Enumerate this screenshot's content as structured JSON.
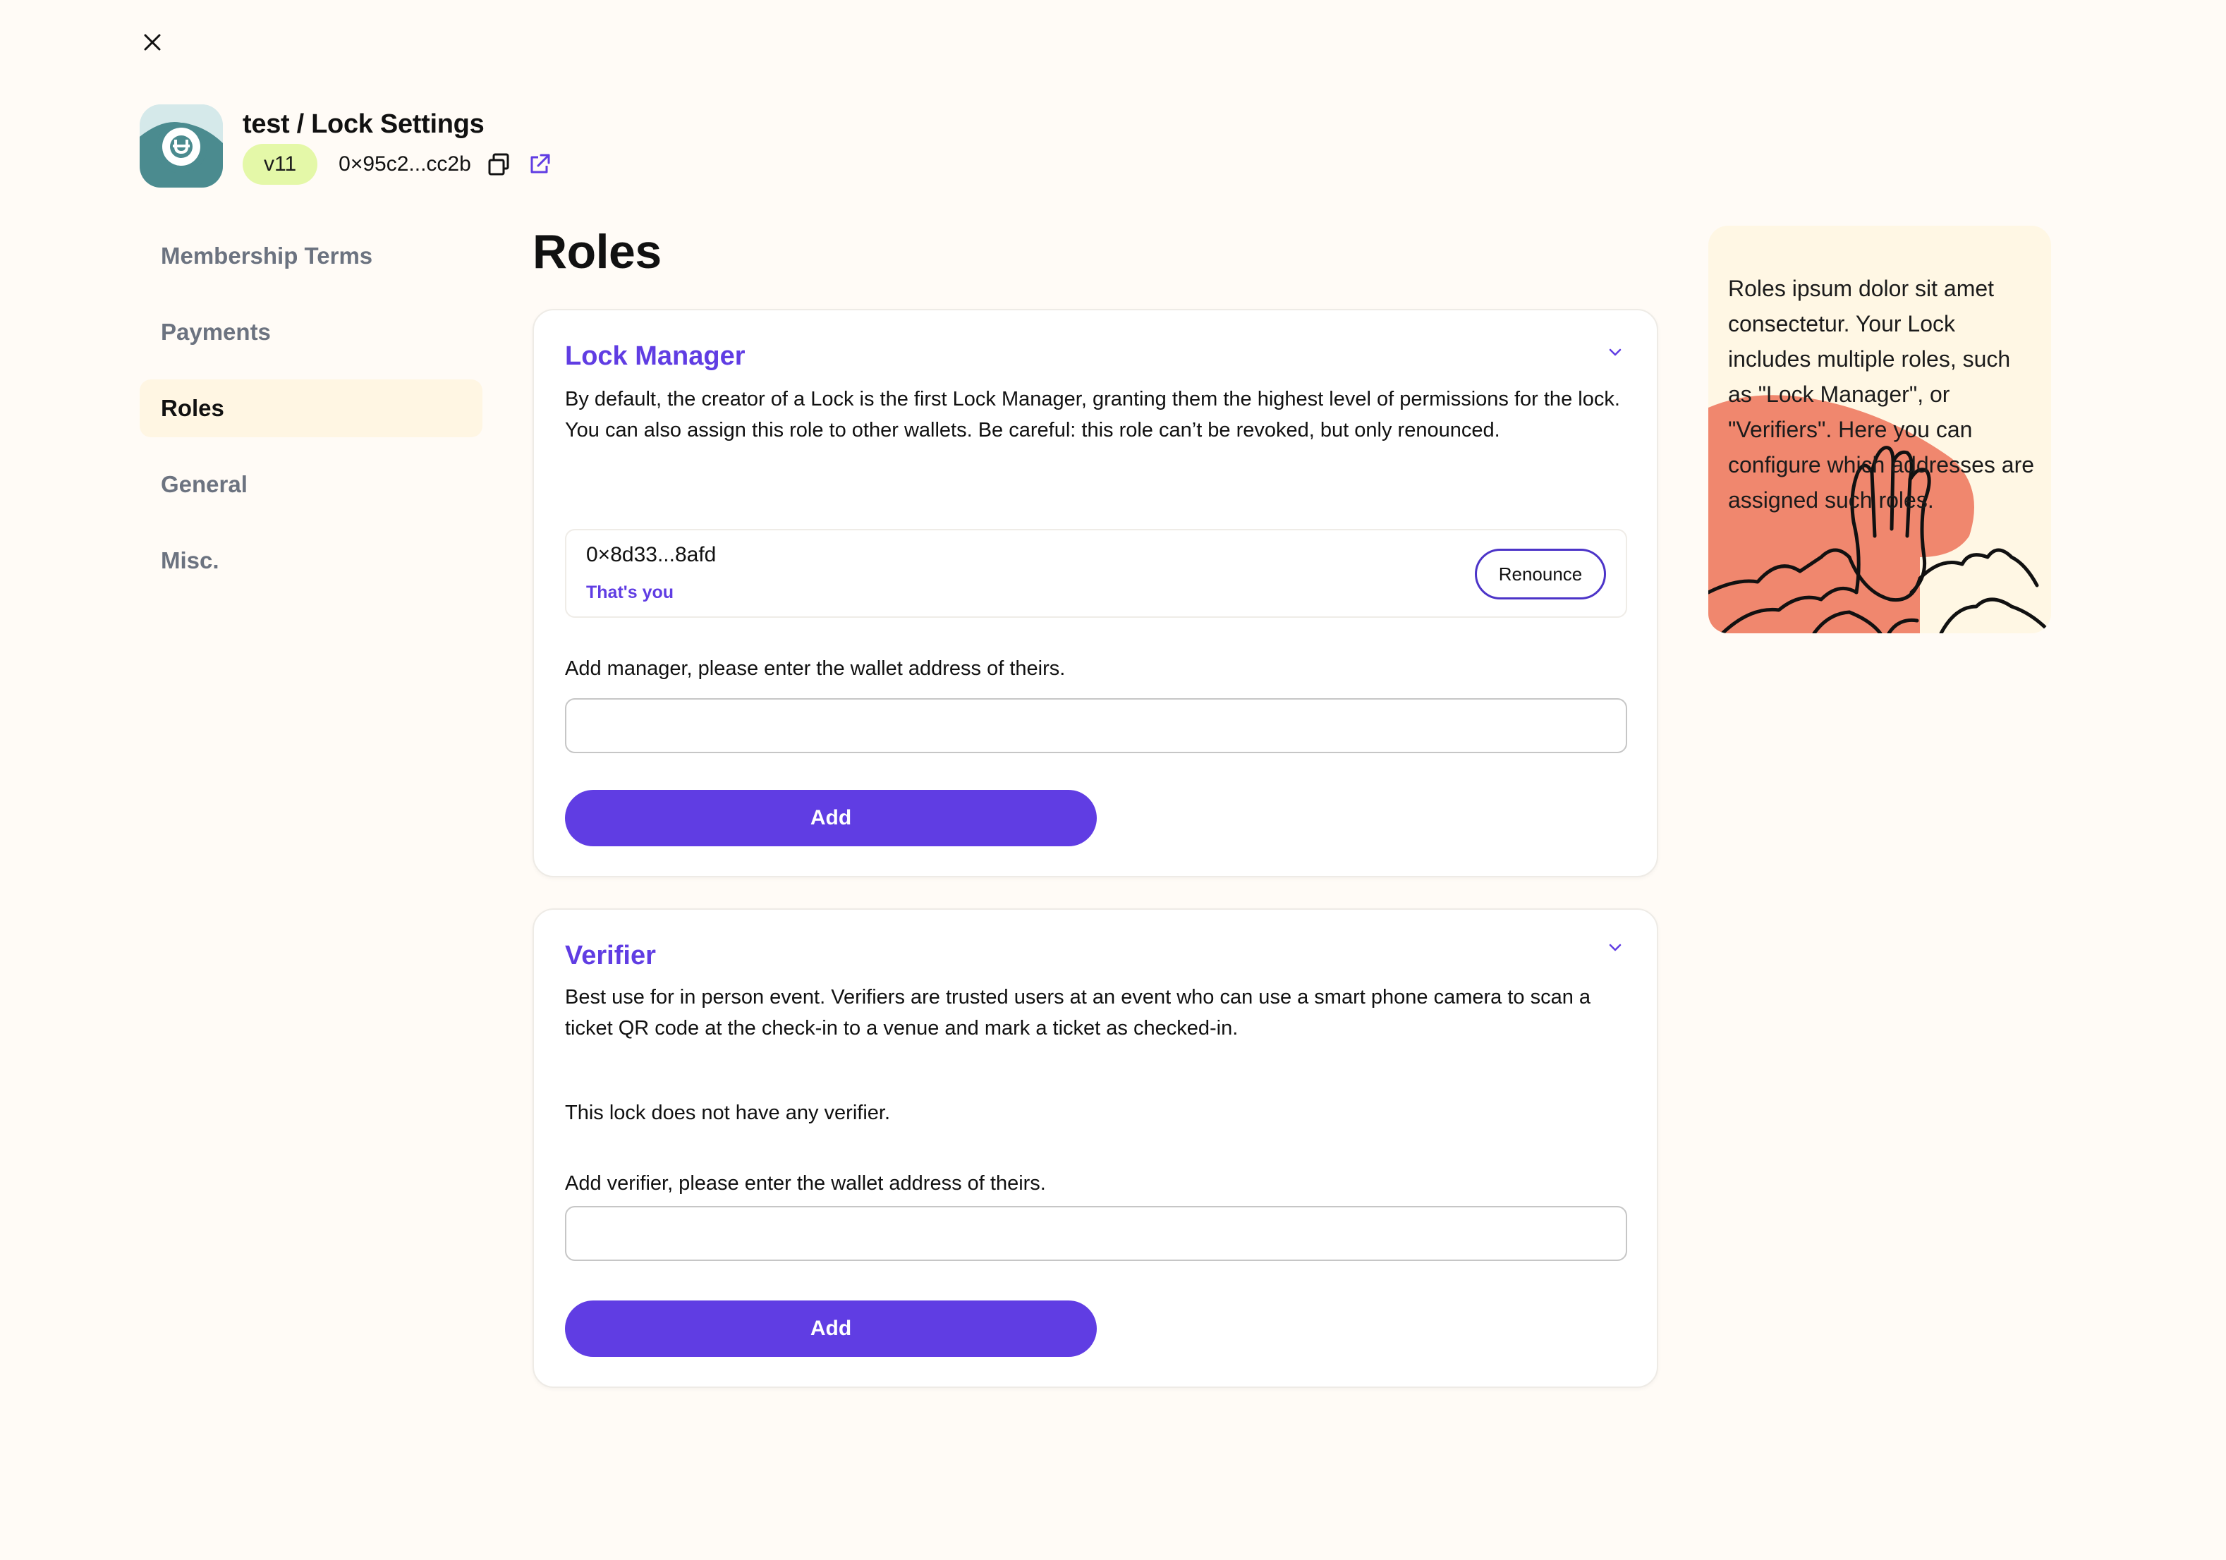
{
  "window": {
    "close_label": "close"
  },
  "header": {
    "title": "test / Lock Settings",
    "version": "v11",
    "address": "0×95c2...cc2b"
  },
  "sidebar": {
    "items": [
      {
        "label": "Membership Terms",
        "active": false
      },
      {
        "label": "Payments",
        "active": false
      },
      {
        "label": "Roles",
        "active": true
      },
      {
        "label": "General",
        "active": false
      },
      {
        "label": "Misc.",
        "active": false
      }
    ]
  },
  "main": {
    "title": "Roles",
    "lock_manager": {
      "title": "Lock Manager",
      "description": "By default, the creator of a Lock is the first Lock Manager, granting them the highest level of permissions for the lock. You can also assign this role to other wallets. Be careful: this role can’t be revoked, but only renounced.",
      "members": [
        {
          "address": "0×8d33...8afd",
          "note": "That's you",
          "action_label": "Renounce"
        }
      ],
      "add_label": "Add manager, please enter the wallet address of theirs.",
      "input_value": "",
      "add_button": "Add"
    },
    "verifier": {
      "title": "Verifier",
      "description": "Best use for in person event. Verifiers are trusted users at an event who can use a smart phone camera to scan a ticket QR code at the check-in to a venue and mark a ticket as checked-in.",
      "empty_text": "This lock does not have any verifier.",
      "add_label": "Add verifier, please enter the wallet address of theirs.",
      "input_value": "",
      "add_button": "Add"
    }
  },
  "help": {
    "text": "Roles ipsum dolor sit amet consectetur. Your Lock includes multiple roles, such as \"Lock Manager\", or \"Verifiers\". Here you can configure which addresses are assigned such roles."
  },
  "colors": {
    "accent": "#603de3",
    "background": "#fffbf6",
    "version_badge": "#e4f8a8",
    "active_nav": "#fff6e3",
    "help_panel": "#fff7e4",
    "illustration_blob": "#f0876e"
  },
  "icons": [
    "close-icon",
    "unlock-logo-icon",
    "copy-icon",
    "external-link-icon",
    "chevron-down-icon"
  ]
}
